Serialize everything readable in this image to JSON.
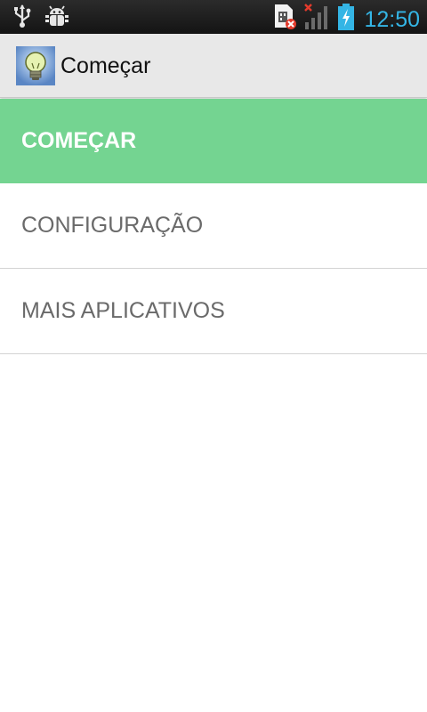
{
  "status_bar": {
    "time": "12:50",
    "icons_left": [
      "usb-icon",
      "android-debug-icon"
    ],
    "icons_right": [
      "sim-error-icon",
      "signal-no-service-icon",
      "battery-charging-icon"
    ],
    "time_color": "#34b5e5"
  },
  "action_bar": {
    "title": "Começar",
    "icon": "lightbulb-app-icon"
  },
  "menu": {
    "items": [
      {
        "label": "COMEÇAR",
        "selected": true
      },
      {
        "label": "CONFIGURAÇÃO",
        "selected": false
      },
      {
        "label": "MAIS APLICATIVOS",
        "selected": false
      }
    ]
  },
  "colors": {
    "active_item_bg": "#74d491",
    "action_bar_bg": "#e8e8e8",
    "inactive_text": "#6a6a6a"
  }
}
